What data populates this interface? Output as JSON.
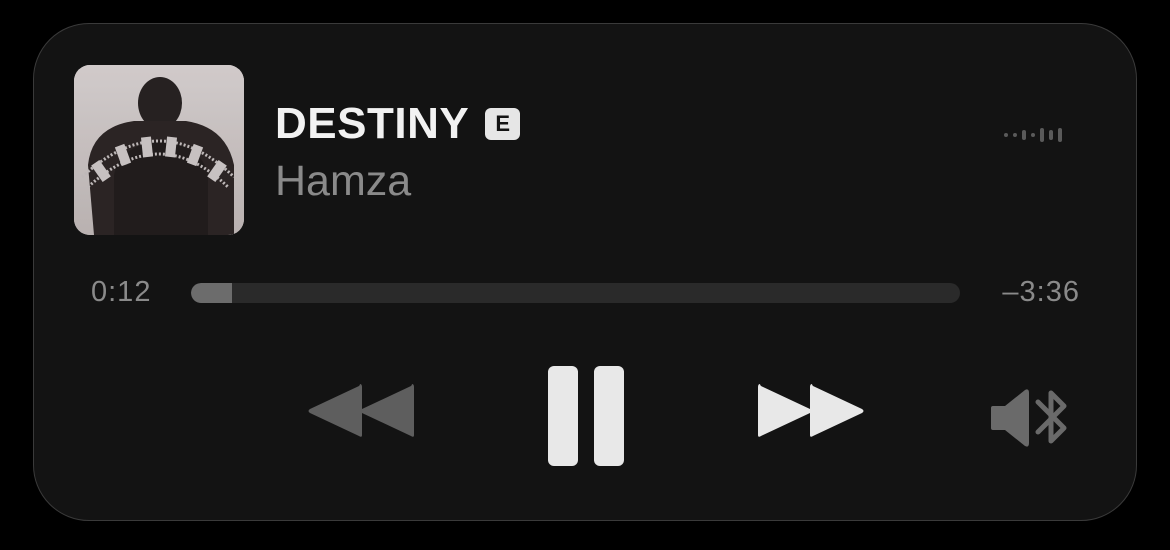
{
  "now_playing": {
    "title": "DESTINY",
    "explicit_badge": "E",
    "artist": "Hamza",
    "elapsed": "0:12",
    "remaining": "–3:36",
    "progress": 0.053
  },
  "controls": {
    "rewind_icon": "backward-icon",
    "pause_icon": "pause-icon",
    "forward_icon": "forward-icon",
    "audio_output_icon": "speaker-bluetooth-icon"
  },
  "colors": {
    "background": "#000000",
    "panel": "#131313",
    "title": "#f2f2f2",
    "subtitle": "#8a8a8a",
    "track": "#2a2a2a",
    "fill": "#6c6c6c",
    "disabled_control": "#5e5e5e",
    "active_control": "#e8e8e8"
  }
}
